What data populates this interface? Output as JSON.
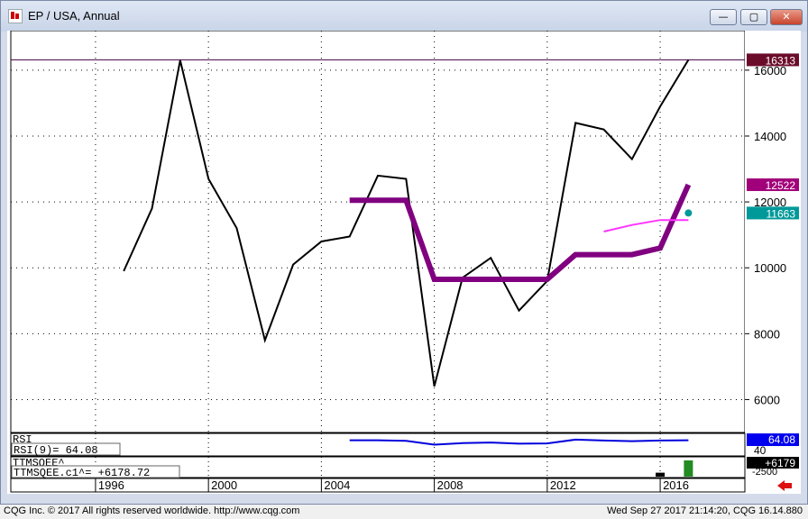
{
  "window": {
    "title": "EP / USA, Annual",
    "min_glyph": "—",
    "max_glyph": "▢",
    "close_glyph": "✕"
  },
  "footer": {
    "copyright": "CQG Inc. © 2017 All rights reserved worldwide. http://www.cqg.com",
    "status": "Wed Sep 27 2017 21:14:20, CQG 16.14.880"
  },
  "chart_data": {
    "type": "line",
    "x_labels": [
      "1996",
      "2000",
      "2004",
      "2008",
      "2012",
      "2016"
    ],
    "y_ticks": [
      6000,
      8000,
      10000,
      12000,
      14000,
      16000
    ],
    "y_range": [
      5000,
      17200
    ],
    "x_range": [
      1993,
      2019
    ],
    "grid": true,
    "series": [
      {
        "color": "#000000",
        "width": 2,
        "points": [
          [
            1997,
            9900
          ],
          [
            1998,
            11800
          ],
          [
            1999,
            16300
          ],
          [
            2000,
            12700
          ],
          [
            2001,
            11200
          ],
          [
            2002,
            7800
          ],
          [
            2003,
            10100
          ],
          [
            2004,
            10800
          ],
          [
            2005,
            10950
          ],
          [
            2006,
            12800
          ],
          [
            2007,
            12700
          ],
          [
            2008,
            6400
          ],
          [
            2009,
            9700
          ],
          [
            2010,
            10300
          ],
          [
            2011,
            8700
          ],
          [
            2012,
            9600
          ],
          [
            2013,
            14400
          ],
          [
            2014,
            14200
          ],
          [
            2015,
            13300
          ],
          [
            2016,
            14900
          ],
          [
            2017,
            16313
          ]
        ]
      },
      {
        "color": "#800080",
        "width": 6,
        "points": [
          [
            2005,
            12050
          ],
          [
            2006,
            12050
          ],
          [
            2007,
            12050
          ],
          [
            2008,
            9650
          ],
          [
            2009,
            9650
          ],
          [
            2010,
            9650
          ],
          [
            2011,
            9650
          ],
          [
            2012,
            9650
          ],
          [
            2013,
            10400
          ],
          [
            2014,
            10400
          ],
          [
            2015,
            10400
          ],
          [
            2016,
            10600
          ],
          [
            2017,
            12522
          ]
        ]
      },
      {
        "color": "#ff33ff",
        "width": 2,
        "points": [
          [
            2014,
            11100
          ],
          [
            2015,
            11300
          ],
          [
            2016,
            11450
          ],
          [
            2017,
            11450
          ]
        ]
      }
    ],
    "marker": {
      "color": "#009999",
      "point": [
        2017,
        11663
      ]
    },
    "hline": {
      "value": 16313,
      "color": "#400040"
    },
    "price_labels": [
      {
        "text": "16313",
        "value": 16313,
        "bg": "#6b0b2a",
        "fg": "#ffffff"
      },
      {
        "text": "12522",
        "value": 12522,
        "bg": "#a1007a",
        "fg": "#ffffff"
      },
      {
        "text": "11663",
        "value": 11663,
        "bg": "#009999",
        "fg": "#ffffff"
      }
    ],
    "rsi": {
      "title": "RSI",
      "readout": "RSI(9)=   64.08",
      "label": "64.08",
      "tick": "40",
      "color": "#0000dd",
      "points": [
        [
          2005,
          64
        ],
        [
          2006,
          64
        ],
        [
          2007,
          62
        ],
        [
          2008,
          50
        ],
        [
          2009,
          55
        ],
        [
          2010,
          57
        ],
        [
          2011,
          53
        ],
        [
          2012,
          54
        ],
        [
          2013,
          66
        ],
        [
          2014,
          63
        ],
        [
          2015,
          61
        ],
        [
          2016,
          63
        ],
        [
          2017,
          64.08
        ]
      ]
    },
    "ttm": {
      "title": "TTMSQEE^",
      "readout": "TTMSQEE.c1^=  +6178.72",
      "label": "+6179",
      "tick": "-2500",
      "bars": [
        {
          "x": 2016,
          "value": 1500,
          "color": "#000000"
        },
        {
          "x": 2017,
          "value": 6179,
          "color": "#228b22"
        }
      ]
    }
  }
}
